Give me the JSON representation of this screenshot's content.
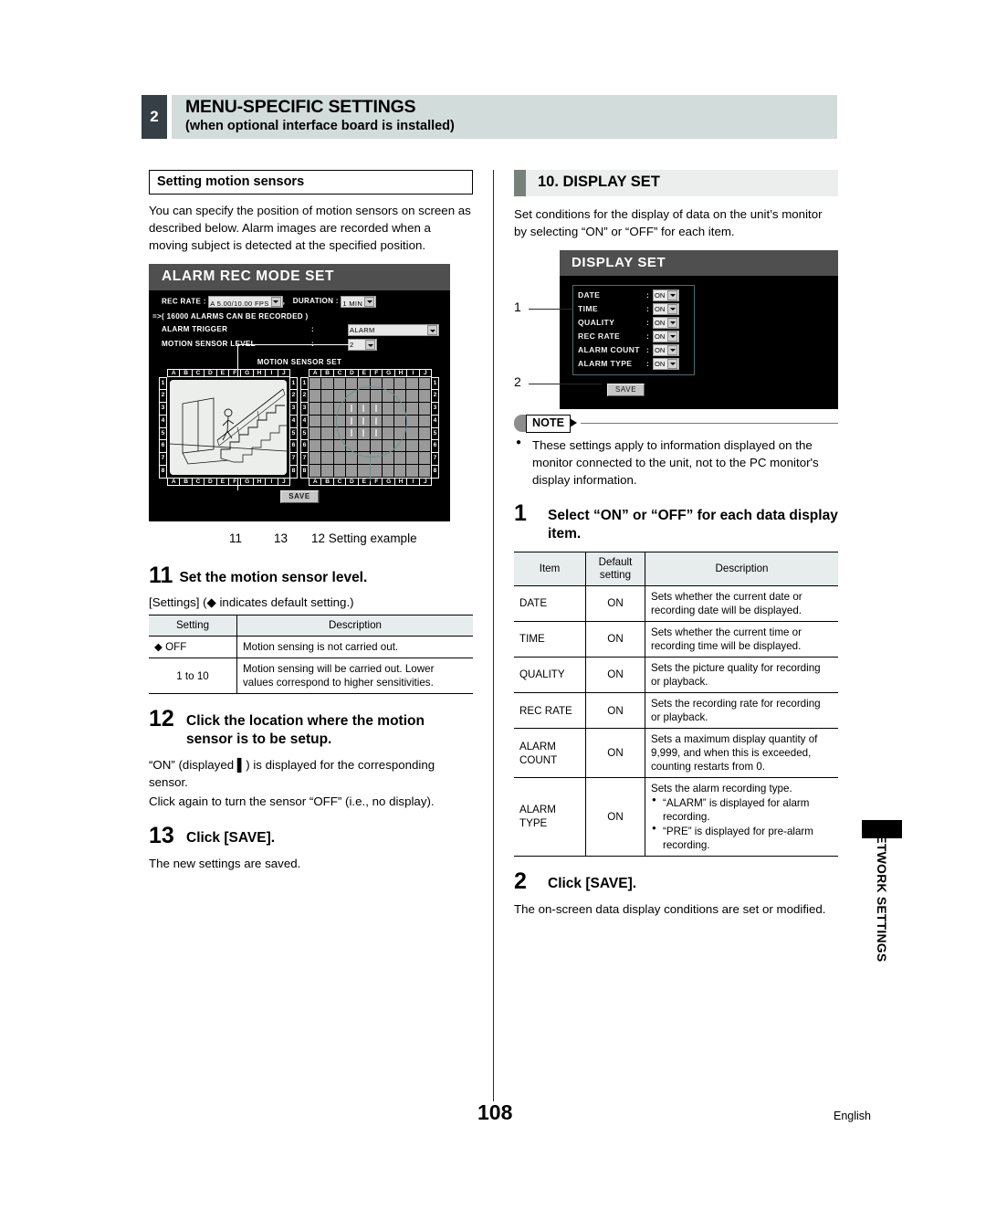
{
  "header": {
    "chapter_number": "2",
    "title": "MENU-SPECIFIC SETTINGS",
    "subtitle": "(when optional interface board is installed)"
  },
  "left_column": {
    "subsection_title": "Setting motion sensors",
    "intro": "You can specify the position of motion sensors on screen as described below. Alarm images are recorded when a moving subject is detected at the specified position.",
    "alarm_screen": {
      "title": "ALARM REC MODE SET",
      "rec_rate_label": "REC RATE :",
      "rec_rate_value": "A 5.00/10.00 FPS",
      "duration_label": "DURATION :",
      "duration_value": "1 MIN",
      "comma": ",",
      "alarms_note": "=>( 16000 ALARMS CAN BE RECORDED )",
      "alarm_trigger_label": "ALARM TRIGGER",
      "alarm_trigger_colon": ":",
      "alarm_trigger_value": "ALARM",
      "motion_sensor_level_label": "MOTION SENSOR LEVEL",
      "motion_sensor_level_colon": ":",
      "motion_sensor_level_value": "2",
      "motion_sensor_set_title": "MOTION SENSOR SET",
      "column_labels": [
        "A",
        "B",
        "C",
        "D",
        "E",
        "F",
        "G",
        "H",
        "I",
        "J"
      ],
      "row_labels": [
        "1",
        "2",
        "3",
        "4",
        "5",
        "6",
        "7",
        "8"
      ],
      "sensors_on": [
        "D3",
        "E3",
        "F3",
        "D4",
        "E4",
        "F4",
        "D5",
        "E5",
        "F5"
      ],
      "save_label": "SAVE"
    },
    "callouts": {
      "c11": "11",
      "c13": "13",
      "c12": "12 Setting example"
    },
    "step11": {
      "number": "11",
      "text": "Set the motion sensor level.",
      "settings_note": "[Settings] (◆ indicates default setting.)",
      "table": {
        "headers": [
          "Setting",
          "Description"
        ],
        "rows": [
          [
            "◆ OFF",
            "Motion sensing is not carried out."
          ],
          [
            "1 to 10",
            "Motion sensing will be carried out. Lower values correspond to higher sensitivities."
          ]
        ]
      }
    },
    "step12": {
      "number": "12",
      "text": "Click the location where the motion sensor is to be setup.",
      "body1": "“ON” (displayed ▌) is displayed for the corresponding sensor.",
      "body2": "Click again to turn the sensor “OFF” (i.e., no display)."
    },
    "step13": {
      "number": "13",
      "text": "Click [SAVE].",
      "body": "The new settings are saved."
    }
  },
  "right_column": {
    "section_title": "10. DISPLAY SET",
    "intro": "Set conditions for the display of data on the unit’s monitor by selecting “ON” or “OFF” for each item.",
    "display_screen": {
      "title": "DISPLAY SET",
      "items": [
        {
          "name": "DATE",
          "colon": ":",
          "value": "ON"
        },
        {
          "name": "TIME",
          "colon": ":",
          "value": "ON"
        },
        {
          "name": "QUALITY",
          "colon": ":",
          "value": "ON"
        },
        {
          "name": "REC RATE",
          "colon": ":",
          "value": "ON"
        },
        {
          "name": "ALARM COUNT",
          "colon": ":",
          "value": "ON"
        },
        {
          "name": "ALARM TYPE",
          "colon": ":",
          "value": "ON"
        }
      ],
      "save_label": "SAVE",
      "callout_1": "1",
      "callout_2": "2"
    },
    "note": {
      "label": "NOTE",
      "text": "These settings apply to information displayed on the monitor connected to the unit, not to the PC monitor's display information."
    },
    "step1": {
      "number": "1",
      "text": "Select “ON” or “OFF” for each data display item.",
      "table": {
        "headers": [
          "Item",
          "Default setting",
          "Description"
        ],
        "rows": [
          {
            "item": "DATE",
            "default": "ON",
            "description": "Sets whether the current date or recording date will be displayed.",
            "bullets": []
          },
          {
            "item": "TIME",
            "default": "ON",
            "description": "Sets whether the current time or recording time will be displayed.",
            "bullets": []
          },
          {
            "item": "QUALITY",
            "default": "ON",
            "description": "Sets the picture quality for recording or playback.",
            "bullets": []
          },
          {
            "item": "REC RATE",
            "default": "ON",
            "description": "Sets the recording rate for recording or playback.",
            "bullets": []
          },
          {
            "item": "ALARM COUNT",
            "default": "ON",
            "description": "Sets a maximum display quantity of 9,999, and when this is exceeded, counting restarts from 0.",
            "bullets": []
          },
          {
            "item": "ALARM TYPE",
            "default": "ON",
            "description": "Sets the alarm recording type.",
            "bullets": [
              "“ALARM” is displayed for alarm recording.",
              "“PRE” is displayed for pre-alarm recording."
            ]
          }
        ]
      }
    },
    "step2": {
      "number": "2",
      "text": "Click [SAVE].",
      "body": "The on-screen data display conditions are set or modified."
    }
  },
  "side_tab": {
    "label": "NETWORK SETTINGS"
  },
  "footer": {
    "page_number": "108",
    "language": "English"
  },
  "colors": {
    "header_band": "#d2dcda",
    "chapter_badge": "#353f45",
    "section_head_bg": "#eceeee",
    "section_tab": "#778079",
    "osd_title_bg": "#4f4f4f",
    "table_header_bg": "#e7ecec",
    "sensor_cell": "#9a9a9a"
  }
}
